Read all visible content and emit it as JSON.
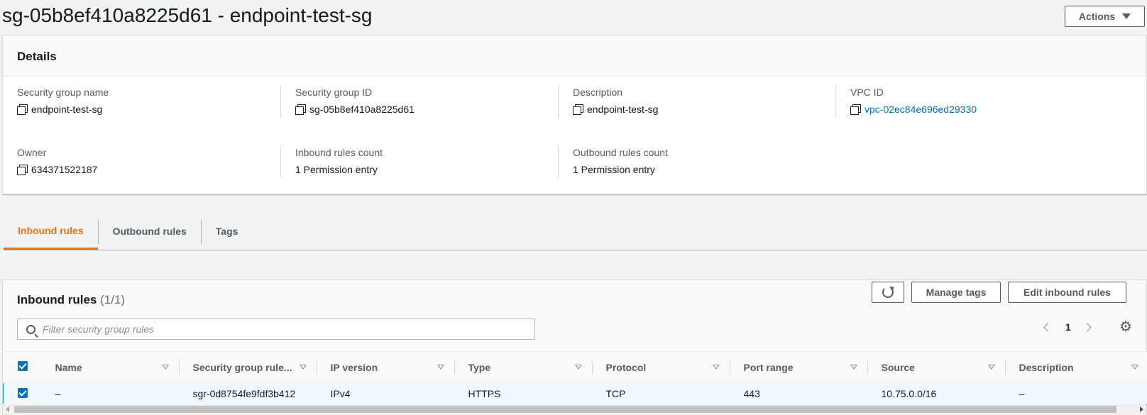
{
  "page": {
    "title": "sg-05b8ef410a8225d61 - endpoint-test-sg",
    "actions_label": "Actions"
  },
  "details": {
    "title": "Details",
    "fields": [
      {
        "label": "Security group name",
        "value": "endpoint-test-sg",
        "copyable": true
      },
      {
        "label": "Security group ID",
        "value": "sg-05b8ef410a8225d61",
        "copyable": true
      },
      {
        "label": "Description",
        "value": "endpoint-test-sg",
        "copyable": true
      },
      {
        "label": "VPC ID",
        "value": "vpc-02ec84e696ed29330",
        "copyable": true,
        "link": true
      },
      {
        "label": "Owner",
        "value": "634371522187",
        "copyable": true
      },
      {
        "label": "Inbound rules count",
        "value": "1 Permission entry"
      },
      {
        "label": "Outbound rules count",
        "value": "1 Permission entry"
      }
    ]
  },
  "tabs": [
    {
      "label": "Inbound rules",
      "active": true
    },
    {
      "label": "Outbound rules",
      "active": false
    },
    {
      "label": "Tags",
      "active": false
    }
  ],
  "rules": {
    "title": "Inbound rules",
    "count": "(1/1)",
    "manage_tags_label": "Manage tags",
    "edit_label": "Edit inbound rules",
    "filter_placeholder": "Filter security group rules",
    "page_number": "1",
    "columns": [
      "Name",
      "Security group rule...",
      "IP version",
      "Type",
      "Protocol",
      "Port range",
      "Source",
      "Description"
    ],
    "rows": [
      {
        "selected": true,
        "cells": [
          "–",
          "sgr-0d8754fe9fdf3b412",
          "IPv4",
          "HTTPS",
          "TCP",
          "443",
          "10.75.0.0/16",
          "–"
        ]
      }
    ]
  },
  "colors": {
    "accent_orange": "#ec7211",
    "link_blue": "#0073bb",
    "selection_border": "#00a1c9"
  }
}
